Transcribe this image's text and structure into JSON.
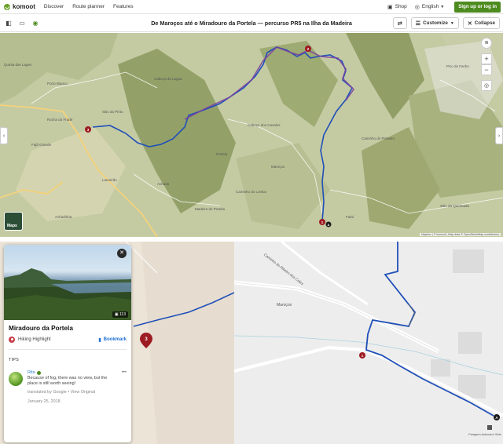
{
  "nav": {
    "logo": "komoot",
    "links": [
      "Discover",
      "Route planner",
      "Features"
    ],
    "shop": "Shop",
    "language": "English",
    "signup": "Sign up or log in"
  },
  "toolbar": {
    "title": "De Maroços até o Miradouro da Portela — percurso PR5 na Ilha da Madeira",
    "customize": "Customize",
    "collapse": "Collapse"
  },
  "topmap": {
    "compass": "N",
    "layers_label": "Maps",
    "attribution": "Mapbox | © komoot | Map data © OpenStreetMap contributors",
    "labels": [
      {
        "text": "Quinta das Lages"
      },
      {
        "text": "Porto Bianco"
      },
      {
        "text": "Cabeça da Lagoa"
      },
      {
        "text": "Sitio do Pinto"
      },
      {
        "text": "Rocha do Frade"
      },
      {
        "text": "Fajã Grande"
      },
      {
        "text": "Achada"
      },
      {
        "text": "Lameirão"
      },
      {
        "text": "Portela"
      },
      {
        "text": "Madeira do Portela"
      },
      {
        "text": "Faial"
      },
      {
        "text": "Cabeço dos Cavalos"
      },
      {
        "text": "Caminho do Lombo"
      },
      {
        "text": "Pico do Facho"
      },
      {
        "text": "Achadinha"
      },
      {
        "text": "Maroços"
      },
      {
        "text": "Sitio da Queimada"
      },
      {
        "text": "Caminho do Pinheiro"
      }
    ]
  },
  "bottommap": {
    "road_label": "Caminho do Ribeiro dos Cales",
    "place_label": "Maroços",
    "poi_label": "Paragem Autocarro Sete",
    "waypoint_3": "3",
    "waypoint_start": "A"
  },
  "highlight_card": {
    "photo_count": "113",
    "title": "Miradouro da Portela",
    "category": "Hiking Highlight",
    "bookmark": "Bookmark",
    "tips_heading": "TIPS",
    "tip": {
      "author": "Rita",
      "text": "Because of fog, there was no view, but the place is still worth seeing!",
      "translated_by": "translated by Google",
      "view_original": "View Original",
      "date": "January 25, 2018"
    }
  },
  "colors": {
    "brand_green": "#4d8b1f",
    "route_blue": "#1f4fb8",
    "route_purple": "#7b3fa0",
    "waypoint_red": "#9e1b22",
    "bookmark_blue": "#1d6fd6"
  }
}
